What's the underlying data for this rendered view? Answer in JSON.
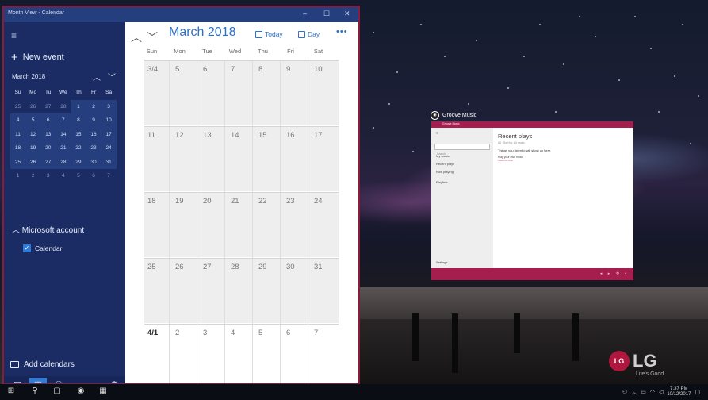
{
  "calendar_window": {
    "title": "Month View - Calendar",
    "controls": [
      "–",
      "☐",
      "✕"
    ]
  },
  "sidebar": {
    "new_event": "New event",
    "mini_month": "March 2018",
    "mini_dow": [
      "Su",
      "Mo",
      "Tu",
      "We",
      "Th",
      "Fr",
      "Sa"
    ],
    "mini_weeks": [
      [
        "25",
        "26",
        "27",
        "28",
        "1",
        "2",
        "3"
      ],
      [
        "4",
        "5",
        "6",
        "7",
        "8",
        "9",
        "10"
      ],
      [
        "11",
        "12",
        "13",
        "14",
        "15",
        "16",
        "17"
      ],
      [
        "18",
        "19",
        "20",
        "21",
        "22",
        "23",
        "24"
      ],
      [
        "25",
        "26",
        "27",
        "28",
        "29",
        "30",
        "31"
      ],
      [
        "1",
        "2",
        "3",
        "4",
        "5",
        "6",
        "7"
      ]
    ],
    "account_header": "Microsoft account",
    "calendar_item": "Calendar",
    "add_calendars": "Add calendars"
  },
  "toolbar": {
    "month_title": "March 2018",
    "today_label": "Today",
    "day_label": "Day",
    "more_label": "•••"
  },
  "month_grid": {
    "dow": [
      "Sun",
      "Mon",
      "Tue",
      "Wed",
      "Thu",
      "Fri",
      "Sat"
    ],
    "weeks": [
      [
        "3/4",
        "5",
        "6",
        "7",
        "8",
        "9",
        "10"
      ],
      [
        "11",
        "12",
        "13",
        "14",
        "15",
        "16",
        "17"
      ],
      [
        "18",
        "19",
        "20",
        "21",
        "22",
        "23",
        "24"
      ],
      [
        "25",
        "26",
        "27",
        "28",
        "29",
        "30",
        "31"
      ],
      [
        "4/1",
        "2",
        "3",
        "4",
        "5",
        "6",
        "7"
      ]
    ]
  },
  "groove": {
    "app_label": "Groove Music",
    "titlebar": "Groove Music",
    "search": "Search",
    "nav": [
      "My music",
      "Recent plays",
      "Now playing",
      "Playlists",
      "Settings"
    ],
    "heading": "Recent plays",
    "subheading": "All · Sort by: All music",
    "empty_text": "Things you listen to will show up here.",
    "platform_text": "Play your own music",
    "platform_link": "Show me how"
  },
  "brand": {
    "logo_mark": "LG",
    "logo_text": "LG",
    "tagline": "Life's Good"
  },
  "taskbar": {
    "time": "7:37 PM",
    "date": "10/12/2017"
  },
  "colors": {
    "accent": "#2b70c9",
    "sidebar": "#1a2c63",
    "window_border": "#8b1a3b",
    "groove_accent": "#a61e4d"
  }
}
